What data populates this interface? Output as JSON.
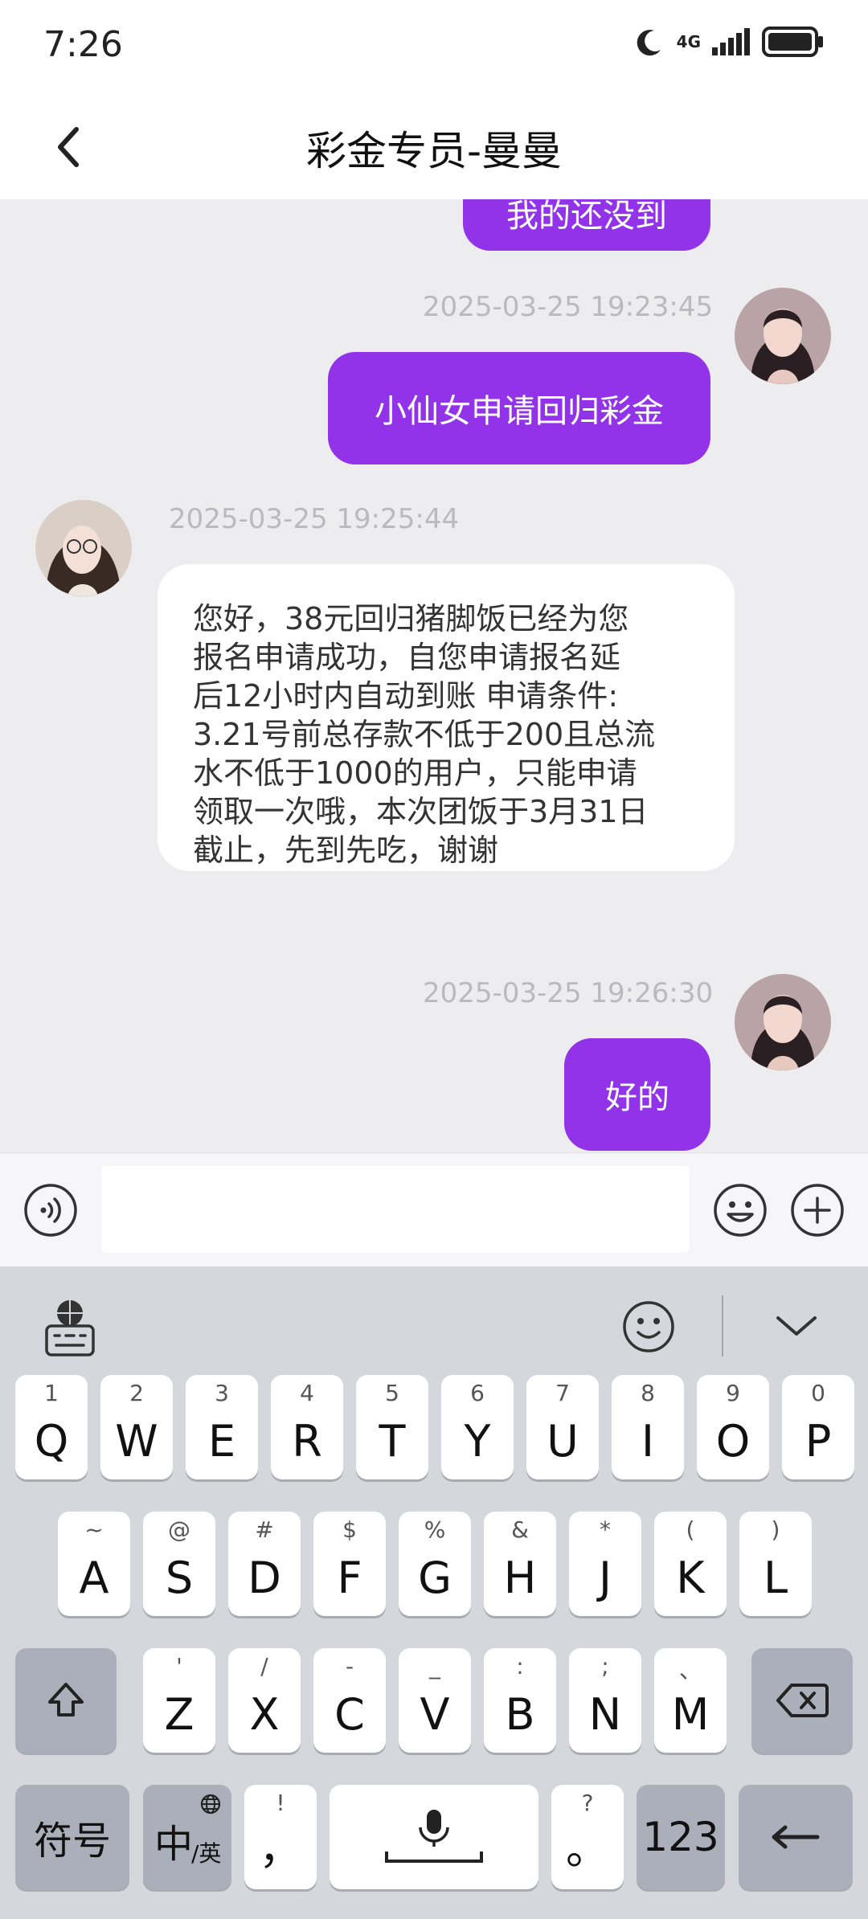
{
  "status": {
    "time": "7:26",
    "network": "4G"
  },
  "header": {
    "title": "彩金专员-曼曼"
  },
  "messages": {
    "m0_text": "我的还没到",
    "m1_time": "2025-03-25 19:23:45",
    "m1_text": "小仙女申请回归彩金",
    "m2_time": "2025-03-25 19:25:44",
    "m2_lines": [
      "您好，38元回归猪脚饭已经为您",
      "报名申请成功，自您申请报名延",
      "后12小时内自动到账 申请条件:",
      "3.21号前总存款不低于200且总流",
      "水不低于1000的用户，只能申请",
      "领取一次哦，本次团饭于3月31日",
      "截止，先到先吃，谢谢"
    ],
    "m3_time": "2025-03-25 19:26:30",
    "m3_text": "好的"
  },
  "input": {
    "value": "",
    "placeholder": ""
  },
  "keyboard": {
    "row1": [
      {
        "main": "Q",
        "sub": "1"
      },
      {
        "main": "W",
        "sub": "2"
      },
      {
        "main": "E",
        "sub": "3"
      },
      {
        "main": "R",
        "sub": "4"
      },
      {
        "main": "T",
        "sub": "5"
      },
      {
        "main": "Y",
        "sub": "6"
      },
      {
        "main": "U",
        "sub": "7"
      },
      {
        "main": "I",
        "sub": "8"
      },
      {
        "main": "O",
        "sub": "9"
      },
      {
        "main": "P",
        "sub": "0"
      }
    ],
    "row2": [
      {
        "main": "A",
        "sub": "~"
      },
      {
        "main": "S",
        "sub": "@"
      },
      {
        "main": "D",
        "sub": "#"
      },
      {
        "main": "F",
        "sub": "$"
      },
      {
        "main": "G",
        "sub": "%"
      },
      {
        "main": "H",
        "sub": "&"
      },
      {
        "main": "J",
        "sub": "*"
      },
      {
        "main": "K",
        "sub": "("
      },
      {
        "main": "L",
        "sub": ")"
      }
    ],
    "row3": [
      {
        "main": "Z",
        "sub": "'"
      },
      {
        "main": "X",
        "sub": "/"
      },
      {
        "main": "C",
        "sub": "-"
      },
      {
        "main": "V",
        "sub": "_"
      },
      {
        "main": "B",
        "sub": ":"
      },
      {
        "main": "N",
        "sub": ";"
      },
      {
        "main": "M",
        "sub": "、"
      }
    ],
    "symbols_label": "符号",
    "lang_main": "中",
    "lang_sub": "/英",
    "comma_main": "，",
    "comma_sub": "!",
    "period_main": "。",
    "period_sub": "?",
    "num_label": "123"
  },
  "colors": {
    "accent": "#9233ea",
    "chat_bg": "#ededf0",
    "key_dark": "#abafb9"
  }
}
